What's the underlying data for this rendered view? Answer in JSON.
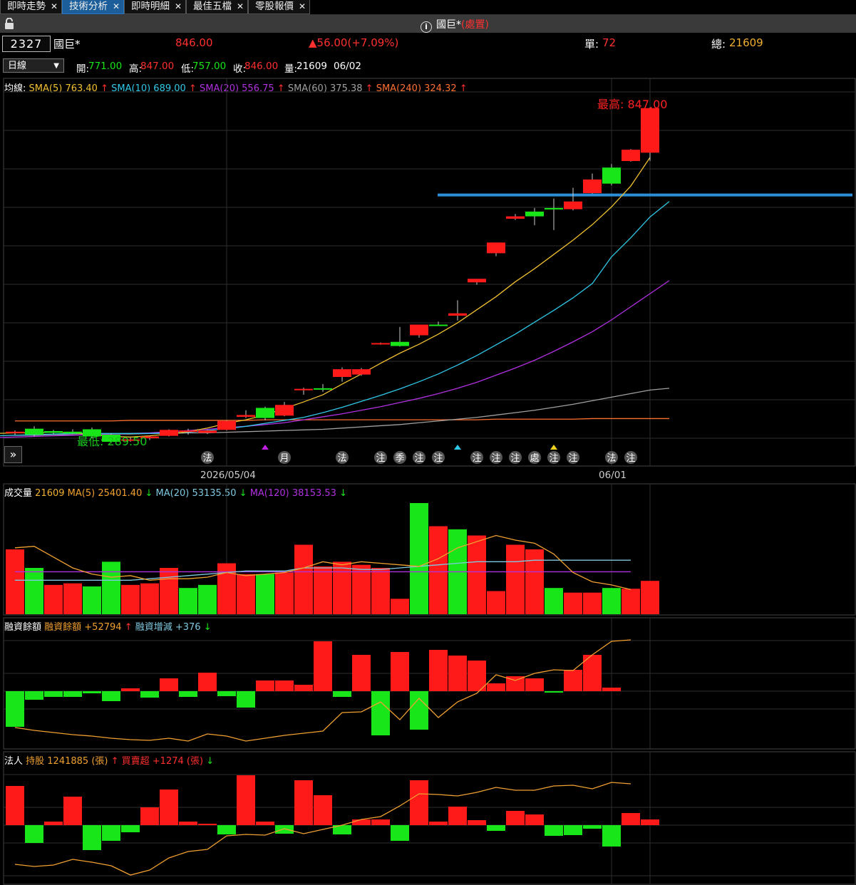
{
  "tabs": [
    {
      "label": "即時走勢",
      "active": false
    },
    {
      "label": "技術分析",
      "active": true
    },
    {
      "label": "即時明細",
      "active": false
    },
    {
      "label": "最佳五檔",
      "active": false
    },
    {
      "label": "零股報價",
      "active": false
    }
  ],
  "tab_close_glyph": "✕",
  "header": {
    "info_icon": "info-icon",
    "stock_name": "國巨*",
    "tag": "(處置)"
  },
  "quote": {
    "code": "2327",
    "name": "國巨*",
    "price": "846.00",
    "change": "▲56.00(+7.09%)",
    "unit_label": "單:",
    "unit_value": "72",
    "total_label": "總:",
    "total_value": "21609"
  },
  "ohlc_bar": {
    "period": "日線",
    "open_label": "開:",
    "open": "771.00",
    "high_label": "高:",
    "high": "847.00",
    "low_label": "低:",
    "low": "757.00",
    "close_label": "收:",
    "close": "846.00",
    "vol_label": "量:",
    "vol": "21609",
    "date": "06/02"
  },
  "sma_legend": {
    "prefix": "均線:",
    "items": [
      {
        "text": "SMA(5) 763.40",
        "arrow": "↑",
        "color": "#f0c030"
      },
      {
        "text": "SMA(10) 689.00",
        "arrow": "↑",
        "color": "#30c8e8"
      },
      {
        "text": "SMA(20) 556.75",
        "arrow": "↑",
        "color": "#b030e0"
      },
      {
        "text": "SMA(60) 375.38",
        "arrow": "↑",
        "color": "#a0a0a0"
      },
      {
        "text": "SMA(240) 324.32",
        "arrow": "↑",
        "color": "#ff7030"
      }
    ]
  },
  "annotations": {
    "high_label": "最高: 847.00",
    "low_label": "最低: 289.50"
  },
  "event_markers": [
    "法",
    "月",
    "法",
    "注",
    "季",
    "注",
    "注",
    "注",
    "注",
    "注",
    "處",
    "注",
    "注",
    "法",
    "注"
  ],
  "x_axis": {
    "labels": [
      "2026/05/04",
      "06/01"
    ]
  },
  "volume_legend": {
    "title": "成交量",
    "value": "21609",
    "items": [
      {
        "text": "MA(5) 25401.40",
        "arrow": "↓",
        "color": "#f0a030"
      },
      {
        "text": "MA(20) 53135.50",
        "arrow": "↓",
        "color": "#7ec8e0"
      },
      {
        "text": "MA(120) 38153.53",
        "arrow": "↓",
        "color": "#b030e0"
      }
    ]
  },
  "margin_legend": {
    "title": "融資餘額",
    "items": [
      {
        "text": "融資餘額 +52794",
        "arrow": "↑",
        "color": "#f0a030"
      },
      {
        "text": "融資增減 +376",
        "arrow": "↓",
        "color": "#7ec8e0"
      }
    ]
  },
  "inst_legend": {
    "title": "法人",
    "items": [
      {
        "text": "持股 1241885 (張)",
        "arrow": "↑",
        "color": "#f0a030"
      },
      {
        "text": "買賣超 +1274 (張)",
        "arrow": "↓",
        "color": "#ff3030"
      }
    ]
  },
  "colors": {
    "up": "#ff1a1a",
    "down": "#19e619",
    "background": "#000000",
    "resistance_line": "#2a8fd8"
  },
  "chart_data": [
    {
      "type": "candlestick",
      "title": "國巨* 日線",
      "ylim": [
        285,
        860
      ],
      "candles": [
        {
          "o": 300,
          "h": 304,
          "l": 296,
          "c": 302
        },
        {
          "o": 307,
          "h": 311,
          "l": 294,
          "c": 297
        },
        {
          "o": 303,
          "h": 305,
          "l": 298,
          "c": 300
        },
        {
          "o": 302,
          "h": 306,
          "l": 298,
          "c": 299
        },
        {
          "o": 306,
          "h": 309,
          "l": 291,
          "c": 294
        },
        {
          "o": 297,
          "h": 299,
          "l": 283,
          "c": 285
        },
        {
          "o": 287,
          "h": 292,
          "l": 285,
          "c": 289
        },
        {
          "o": 291,
          "h": 295,
          "l": 288,
          "c": 294
        },
        {
          "o": 295,
          "h": 306,
          "l": 294,
          "c": 305
        },
        {
          "o": 302,
          "h": 307,
          "l": 297,
          "c": 304
        },
        {
          "o": 300,
          "h": 305,
          "l": 298,
          "c": 304
        },
        {
          "o": 305,
          "h": 321,
          "l": 304,
          "c": 320
        },
        {
          "o": 327,
          "h": 338,
          "l": 325,
          "c": 330
        },
        {
          "o": 342,
          "h": 344,
          "l": 321,
          "c": 325
        },
        {
          "o": 329,
          "h": 352,
          "l": 328,
          "c": 347
        },
        {
          "o": 374,
          "h": 376,
          "l": 364,
          "c": 374
        },
        {
          "o": 375,
          "h": 382,
          "l": 369,
          "c": 374
        },
        {
          "o": 394,
          "h": 410,
          "l": 386,
          "c": 407
        },
        {
          "o": 398,
          "h": 409,
          "l": 396,
          "c": 407
        },
        {
          "o": 450,
          "h": 452,
          "l": 448,
          "c": 451
        },
        {
          "o": 453,
          "h": 478,
          "l": 445,
          "c": 446
        },
        {
          "o": 464,
          "h": 482,
          "l": 460,
          "c": 482
        },
        {
          "o": 482,
          "h": 487,
          "l": 480,
          "c": 480
        },
        {
          "o": 497,
          "h": 523,
          "l": 489,
          "c": 501
        },
        {
          "o": 553,
          "h": 556,
          "l": 549,
          "c": 559
        },
        {
          "o": 602,
          "h": 620,
          "l": 597,
          "c": 620
        },
        {
          "o": 660,
          "h": 668,
          "l": 658,
          "c": 664
        },
        {
          "o": 672,
          "h": 678,
          "l": 649,
          "c": 664
        },
        {
          "o": 678,
          "h": 694,
          "l": 641,
          "c": 676
        },
        {
          "o": 676,
          "h": 712,
          "l": 674,
          "c": 689
        },
        {
          "o": 703,
          "h": 736,
          "l": 702,
          "c": 726
        },
        {
          "o": 746,
          "h": 752,
          "l": 716,
          "c": 719
        },
        {
          "o": 757,
          "h": 777,
          "l": 756,
          "c": 776
        },
        {
          "o": 771,
          "h": 847,
          "l": 757,
          "c": 846
        }
      ],
      "sma5": [
        299,
        300,
        300,
        301,
        300,
        297,
        294,
        293,
        295,
        298,
        302,
        308,
        316,
        322,
        330,
        341,
        352,
        364,
        382,
        399,
        417,
        434,
        449,
        466,
        485,
        507,
        529,
        554,
        576,
        600,
        624,
        650,
        680,
        715,
        763
      ],
      "sma10": [
        294,
        295,
        296,
        297,
        298,
        299,
        299,
        299,
        299,
        299,
        300,
        301,
        304,
        307,
        311,
        316,
        321,
        326,
        334,
        343,
        353,
        363,
        374,
        386,
        399,
        414,
        430,
        448,
        466,
        486,
        506,
        527,
        551,
        596,
        628,
        663,
        689
      ],
      "sma20": [
        289,
        290,
        291,
        292,
        293,
        294,
        295,
        296,
        297,
        298,
        299,
        300,
        302,
        304,
        306,
        309,
        311,
        314,
        317,
        322,
        327,
        332,
        338,
        344,
        351,
        358,
        366,
        375,
        385,
        397,
        409,
        422,
        437,
        453,
        470,
        490,
        512,
        534,
        556
      ],
      "sma60": [
        296,
        296,
        297,
        297,
        297,
        298,
        298,
        299,
        299,
        300,
        300,
        301,
        302,
        303,
        304,
        305,
        306,
        308,
        310,
        312,
        314,
        317,
        320,
        323,
        326,
        330,
        334,
        338,
        343,
        348,
        354,
        360,
        366,
        372,
        375
      ],
      "sma240": [
        320,
        320,
        320,
        320,
        320,
        320,
        321,
        321,
        321,
        321,
        321,
        321,
        321,
        322,
        322,
        322,
        322,
        322,
        322,
        322,
        322,
        322,
        322,
        322,
        322,
        323,
        323,
        323,
        323,
        323,
        324,
        324,
        324,
        324,
        324
      ],
      "resistance": 700,
      "high": 847.0,
      "low": 289.5
    },
    {
      "type": "bar",
      "title": "成交量",
      "values": [
        42000,
        30000,
        19000,
        20000,
        18000,
        34000,
        19000,
        20000,
        30000,
        17000,
        19000,
        33000,
        26000,
        26000,
        27000,
        45000,
        31000,
        34000,
        32000,
        30000,
        10000,
        72000,
        57000,
        55000,
        51000,
        15000,
        45000,
        42000,
        17000,
        14000,
        14000,
        17000,
        16500,
        21609
      ],
      "up": [
        true,
        false,
        true,
        true,
        false,
        false,
        true,
        true,
        true,
        false,
        false,
        true,
        true,
        false,
        true,
        true,
        true,
        true,
        true,
        true,
        true,
        false,
        true,
        false,
        true,
        true,
        true,
        true,
        false,
        true,
        true,
        false,
        true,
        true
      ],
      "ma5": [
        43000,
        44000,
        37000,
        30000,
        26000,
        24000,
        25000,
        22000,
        23000,
        23000,
        24000,
        27000,
        25000,
        26000,
        27000,
        30000,
        34000,
        32000,
        34000,
        33000,
        32000,
        31000,
        36000,
        43000,
        47000,
        51000,
        48000,
        46000,
        39000,
        27000,
        21000,
        19000,
        16000,
        16000,
        25401.4
      ],
      "ma20": [
        22000,
        22000,
        22000,
        22000,
        22000,
        22000,
        22000,
        23000,
        24000,
        25000,
        26000,
        27000,
        28000,
        28000,
        28000,
        30000,
        30000,
        30000,
        29000,
        29000,
        30000,
        31000,
        32000,
        33000,
        34000,
        34000,
        34000,
        35000,
        35000,
        35000,
        35000,
        35000,
        35000,
        35000,
        53135.5
      ],
      "ma120": [
        27500,
        27500,
        27500,
        27500,
        27500,
        27500,
        27500,
        27500,
        27500,
        27500,
        27500,
        27500,
        27500,
        27500,
        27500,
        27500,
        27500,
        27500,
        27500,
        27500,
        27500,
        27500,
        27500,
        27500,
        27500,
        27500,
        27500,
        27500,
        27500,
        27500,
        27500,
        27500,
        27500,
        38153.53
      ]
    },
    {
      "type": "bar",
      "title": "融資餘額",
      "values": [
        -50,
        -12,
        -8,
        -8,
        -3,
        -14,
        4,
        -9,
        18,
        -8,
        26,
        -7,
        -23,
        15,
        15,
        9,
        70,
        -8,
        51,
        -62,
        55,
        -54,
        58,
        50,
        43,
        11,
        21,
        18,
        -2,
        30,
        51,
        5
      ],
      "balance": [
        -51,
        -55,
        -58,
        -61,
        -63,
        -66,
        -68,
        -69,
        -66,
        -70,
        -60,
        -63,
        -70,
        -66,
        -62,
        -59,
        -56,
        -30,
        -29,
        -15,
        -40,
        -10,
        -37,
        -15,
        -3,
        23,
        15,
        25,
        30,
        29,
        51,
        70,
        72
      ]
    },
    {
      "type": "bar",
      "title": "法人",
      "values": [
        55,
        -25,
        5,
        40,
        -35,
        -22,
        -10,
        25,
        50,
        5,
        2,
        -13,
        70,
        5,
        -12,
        63,
        42,
        -13,
        8,
        8,
        -22,
        63,
        5,
        26,
        7,
        -8,
        20,
        15,
        -15,
        -14,
        -5,
        -30,
        17,
        8,
        1274
      ],
      "holdings": [
        -55,
        -58,
        -56,
        -48,
        -52,
        -57,
        -70,
        -63,
        -46,
        -37,
        -34,
        -15,
        -13,
        -14,
        -5,
        -12,
        -6,
        0,
        8,
        12,
        27,
        44,
        43,
        41,
        46,
        53,
        49,
        49,
        55,
        56,
        51,
        60,
        58
      ]
    }
  ]
}
